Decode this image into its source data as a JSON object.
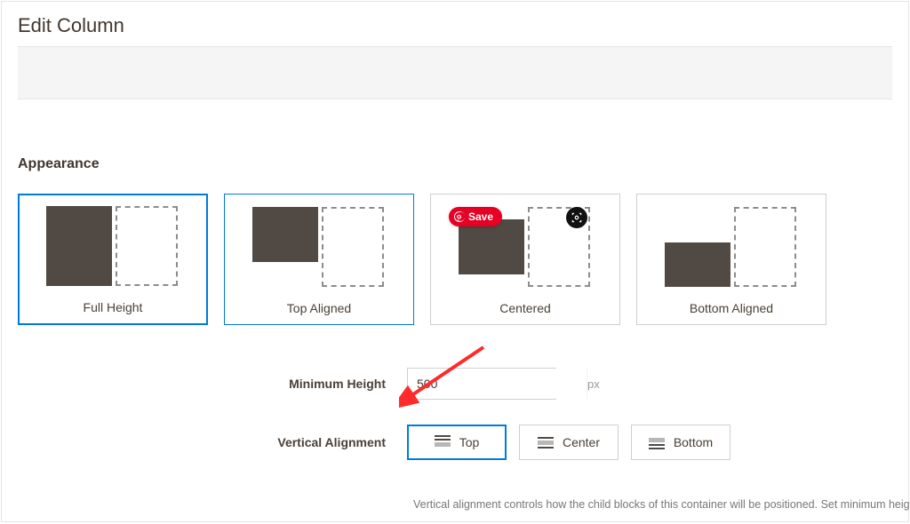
{
  "title": "Edit Column",
  "section": {
    "heading": "Appearance"
  },
  "appearance": {
    "options": [
      {
        "label": "Full Height"
      },
      {
        "label": "Top Aligned"
      },
      {
        "label": "Centered"
      },
      {
        "label": "Bottom Aligned"
      }
    ],
    "save_badge": "Save"
  },
  "form": {
    "min_height_label": "Minimum Height",
    "min_height_value": "500",
    "min_height_unit": "px",
    "valign_label": "Vertical Alignment",
    "valign_options": {
      "top": "Top",
      "center": "Center",
      "bottom": "Bottom"
    }
  },
  "hint": "Vertical alignment controls how the child blocks of this container will be positioned. Set minimum height in",
  "colors": {
    "accent": "#007bdb",
    "pinterest": "#e60023"
  }
}
